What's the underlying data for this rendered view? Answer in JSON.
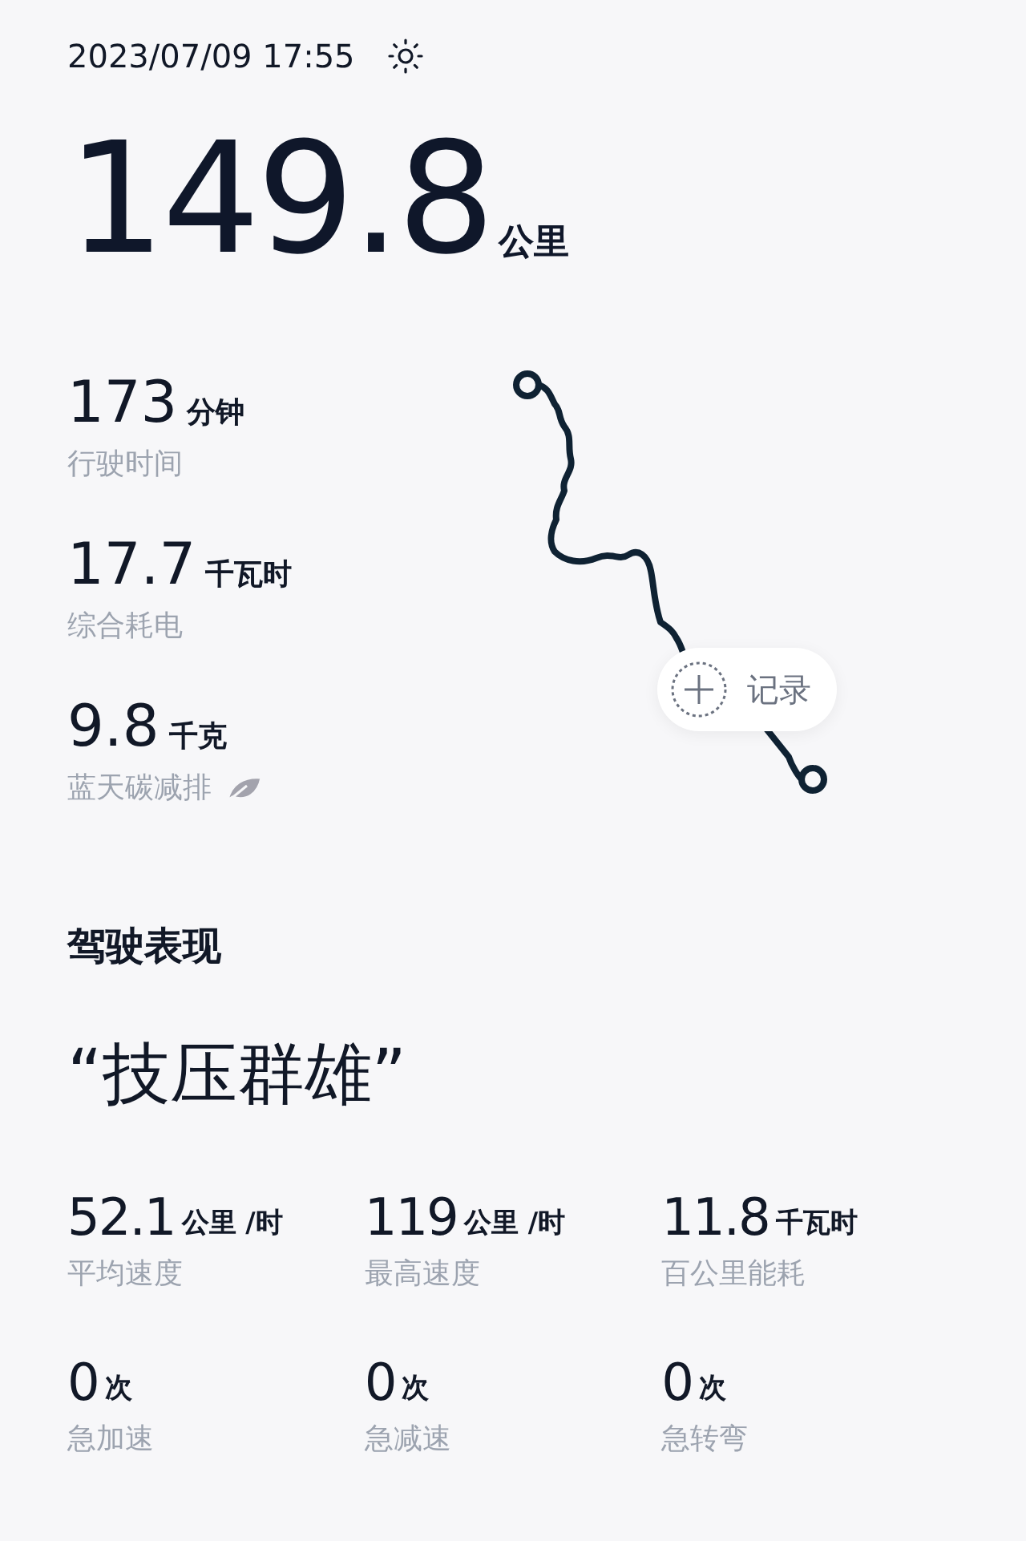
{
  "datetime": "2023/07/09 17:55",
  "distance": {
    "value": "149.8",
    "unit": "公里"
  },
  "trip_stats": [
    {
      "value": "173",
      "unit": "分钟",
      "label": "行驶时间",
      "leaf": false
    },
    {
      "value": "17.7",
      "unit": "千瓦时",
      "label": "综合耗电",
      "leaf": false
    },
    {
      "value": "9.8",
      "unit": "千克",
      "label": "蓝天碳减排",
      "leaf": true
    }
  ],
  "record_button": {
    "label": "记录"
  },
  "performance": {
    "title": "驾驶表现",
    "rating": "“技压群雄”",
    "stats": [
      {
        "value": "52.1",
        "unit": "公里 /时",
        "label": "平均速度"
      },
      {
        "value": "119",
        "unit": "公里 /时",
        "label": "最高速度"
      },
      {
        "value": "11.8",
        "unit": "千瓦时",
        "label": "百公里能耗"
      },
      {
        "value": "0",
        "unit": "次",
        "label": "急加速"
      },
      {
        "value": "0",
        "unit": "次",
        "label": "急减速"
      },
      {
        "value": "0",
        "unit": "次",
        "label": "急转弯"
      }
    ]
  }
}
